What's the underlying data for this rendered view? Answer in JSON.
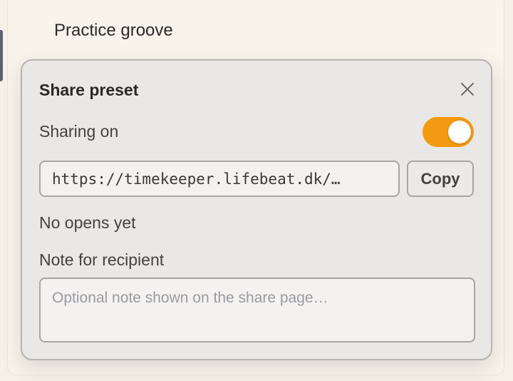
{
  "background": {
    "preset_name": "Practice groove"
  },
  "popover": {
    "title": "Share preset",
    "sharing_label": "Sharing on",
    "sharing_enabled": true,
    "share_url": "https://timekeeper.lifebeat.dk/…",
    "copy_label": "Copy",
    "opens_status": "No opens yet",
    "note_label": "Note for recipient",
    "note_value": "",
    "note_placeholder": "Optional note shown on the share page…"
  },
  "colors": {
    "accent": "#f39a12",
    "popover_bg": "#e9e8e6",
    "page_bg": "#f5f1e9"
  },
  "icons": {
    "close": "close-icon"
  }
}
